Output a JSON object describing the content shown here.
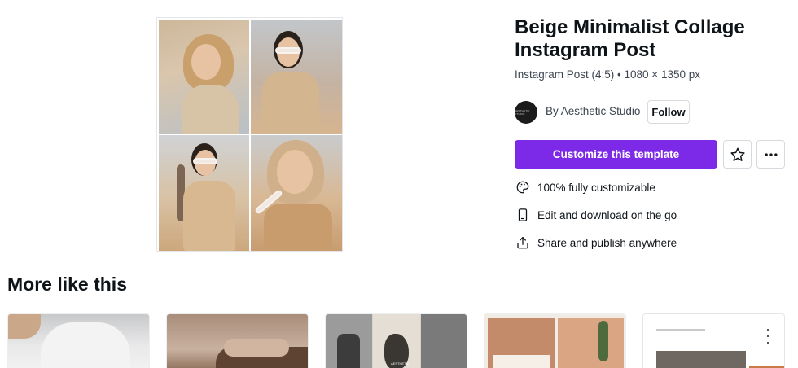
{
  "template": {
    "title": "Beige Minimalist Collage Instagram Post",
    "subtitle": "Instagram Post (4:5) • 1080 × 1350 px",
    "by_prefix": "By",
    "author": "Aesthetic Studio",
    "avatar_text": "AESTHETIC STUDIO",
    "follow_label": "Follow",
    "cta_label": "Customize this template",
    "star_icon": "star-icon",
    "more_icon": "more-horizontal-icon"
  },
  "features": [
    {
      "icon": "palette-icon",
      "label": "100% fully customizable"
    },
    {
      "icon": "phone-icon",
      "label": "Edit and download on the go"
    },
    {
      "icon": "share-icon",
      "label": "Share and publish anywhere"
    }
  ],
  "more": {
    "title": "More like this",
    "thumb3_label": "AESTHETIC"
  },
  "colors": {
    "accent": "#7d2ae8",
    "text": "#0e1318",
    "secondary_text": "#3d4650"
  }
}
